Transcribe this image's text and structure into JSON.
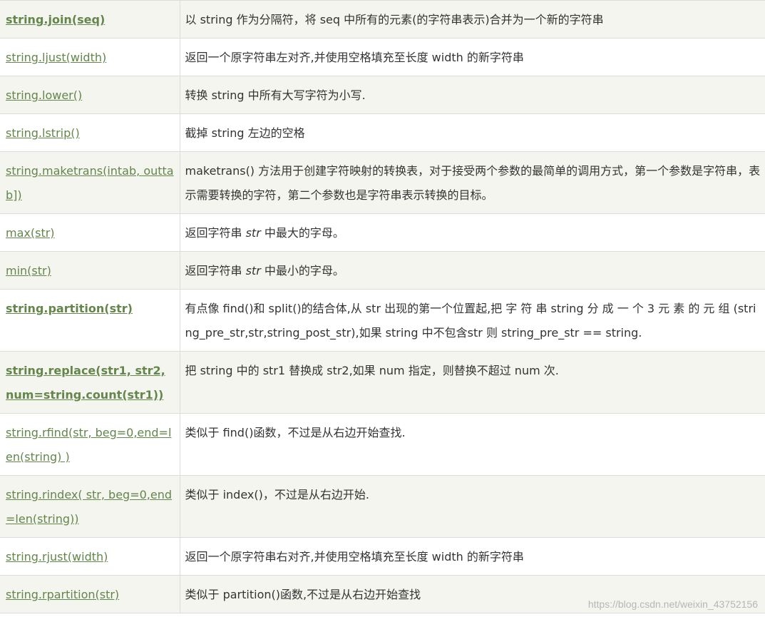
{
  "rows": [
    {
      "method": "string.join(seq)",
      "bold": true,
      "desc": "以 string 作为分隔符，将 seq 中所有的元素(的字符串表示)合并为一个新的字符串",
      "height": 53
    },
    {
      "method": "string.ljust(width)",
      "bold": false,
      "desc": "返回一个原字符串左对齐,并使用空格填充至长度 width 的新字符串",
      "height": 53
    },
    {
      "method": "string.lower()",
      "bold": false,
      "desc": "转换 string 中所有大写字符为小写.",
      "height": 53
    },
    {
      "method": "string.lstrip()",
      "bold": false,
      "desc": "截掉 string 左边的空格",
      "height": 53
    },
    {
      "method": "string.maketrans(intab, outtab])",
      "bold": false,
      "desc": "maketrans() 方法用于创建字符映射的转换表，对于接受两个参数的最简单的调用方式，第一个参数是字符串，表示需要转换的字符，第二个参数也是字符串表示转换的目标。",
      "height": 87
    },
    {
      "method": "max(str)",
      "bold": false,
      "desc_pre": "返回字符串 ",
      "desc_em": "str",
      "desc_post": " 中最大的字母。",
      "height": 53
    },
    {
      "method": "min(str)",
      "bold": false,
      "desc_pre": "返回字符串 ",
      "desc_em": "str",
      "desc_post": " 中最小的字母。",
      "height": 53
    },
    {
      "method": "string.partition(str)",
      "bold": true,
      "desc": "有点像 find()和 split()的结合体,从 str 出现的第一个位置起,把 字 符 串 string 分 成 一 个 3 元 素 的 元 组 (string_pre_str,str,string_post_str),如果 string 中不包含str 则 string_pre_str == string.",
      "height": 87
    },
    {
      "method": "string.replace(str1, str2,  num=string.count(str1))",
      "bold": true,
      "desc": "把 string 中的 str1 替换成 str2,如果 num 指定，则替换不超过 num 次.",
      "height": 87
    },
    {
      "method": "string.rfind(str, beg=0,end=len(string) )",
      "bold": false,
      "desc": "类似于 find()函数，不过是从右边开始查找.",
      "height": 87
    },
    {
      "method": "string.rindex( str, beg=0,end=len(string))",
      "bold": false,
      "desc": "类似于 index()，不过是从右边开始.",
      "height": 87
    },
    {
      "method": "string.rjust(width)",
      "bold": false,
      "desc": "返回一个原字符串右对齐,并使用空格填充至长度 width 的新字符串",
      "height": 53
    },
    {
      "method": "string.rpartition(str)",
      "bold": false,
      "desc": "类似于 partition()函数,不过是从右边开始查找",
      "height": 53
    }
  ],
  "watermark": "https://blog.csdn.net/weixin_43752156",
  "colors": {
    "link": "#64854c",
    "odd_row": "#f5f5ef",
    "border": "#dcdcdc"
  }
}
